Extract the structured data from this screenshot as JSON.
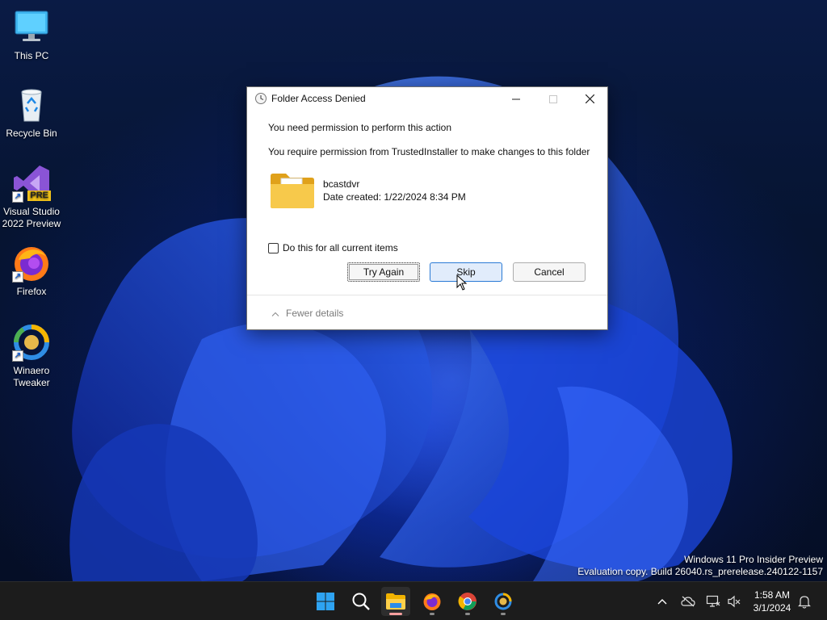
{
  "desktop": {
    "icons": [
      {
        "label": "This PC",
        "icon": "monitor-icon"
      },
      {
        "label": "Recycle Bin",
        "icon": "recycle-bin-icon"
      },
      {
        "label": "Visual Studio 2022 Preview",
        "icon": "visual-studio-icon",
        "badge": "PRE"
      },
      {
        "label": "Firefox",
        "icon": "firefox-icon"
      },
      {
        "label": "Winaero Tweaker",
        "icon": "winaero-tweaker-icon"
      }
    ]
  },
  "dialog": {
    "title": "Folder Access Denied",
    "heading": "You need permission to perform this action",
    "requirement": "You require permission from TrustedInstaller to make changes to this folder",
    "item": {
      "name": "bcastdvr",
      "date_created": "Date created: 1/22/2024 8:34 PM"
    },
    "checkbox_label": "Do this for all current items",
    "checkbox_checked": false,
    "buttons": {
      "try_again": "Try Again",
      "skip": "Skip",
      "cancel": "Cancel"
    },
    "details_toggle": "Fewer details"
  },
  "watermark": {
    "line1": "Windows 11 Pro Insider Preview",
    "line2": "Evaluation copy. Build 26040.rs_prerelease.240122-1157"
  },
  "taskbar": {
    "apps": [
      "start-icon",
      "search-icon",
      "file-explorer-icon",
      "firefox-icon",
      "chrome-icon",
      "winaero-tweaker-icon"
    ],
    "clock": {
      "time": "1:58 AM",
      "date": "3/1/2024"
    }
  },
  "colors": {
    "accent": "#2a7ad5",
    "taskbar": "#1c1c1c",
    "wallpaper": "#1a4de0"
  }
}
